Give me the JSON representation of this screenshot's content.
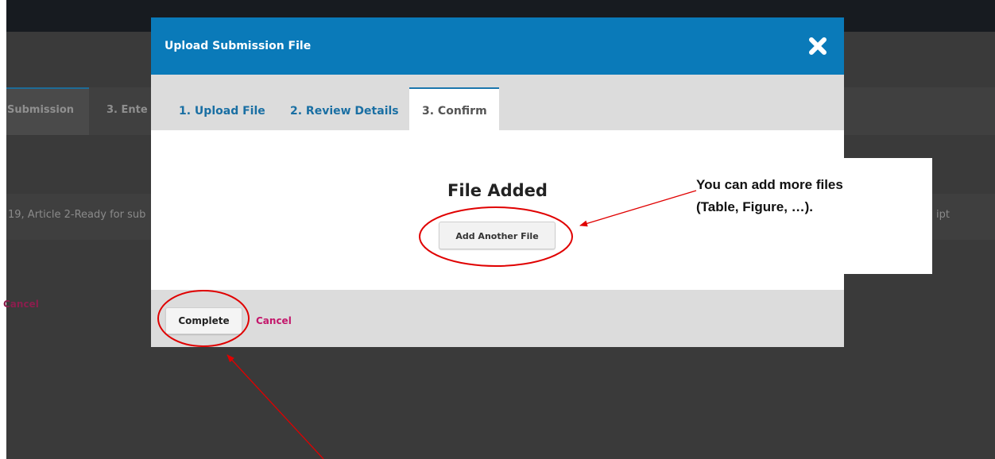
{
  "background": {
    "tabs": [
      "Submission",
      "3. Ente"
    ],
    "row_text": "19, Article 2-Ready for sub",
    "row_text_right": "ipt",
    "cancel_label": "Cancel"
  },
  "modal": {
    "title": "Upload Submission File",
    "tabs": [
      {
        "label": "1. Upload File"
      },
      {
        "label": "2. Review Details"
      },
      {
        "label": "3. Confirm"
      }
    ],
    "heading": "File Added",
    "add_button_label": "Add Another File",
    "complete_label": "Complete",
    "cancel_label": "Cancel"
  },
  "callout": {
    "line1": "You can add more files",
    "line2": "(Table, Figure, …)."
  },
  "colors": {
    "header": "#0a7ab9",
    "tab_link": "#1a6fa3",
    "cancel_link": "#c3176b",
    "annotation": "#e00000"
  },
  "icons": {
    "close": "close-x-icon"
  }
}
